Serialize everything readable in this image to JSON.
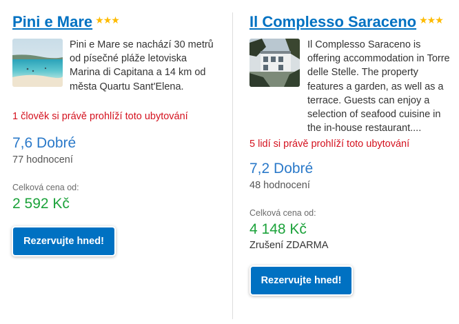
{
  "hotels": [
    {
      "name": "Pini e Mare",
      "stars": "★★★",
      "description": "Pini e Mare se nachází 30 metrů od písečné pláže letoviska Marina di Capitana a 14 km od města Quartu Sant'Elena.",
      "viewers": "1 člověk si právě prohlíží toto ubytování",
      "score": "7,6 Dobré",
      "reviews": "77 hodnocení",
      "price_label": "Celková cena od:",
      "price": "2 592 Kč",
      "button_label": "Rezervujte hned!"
    },
    {
      "name": "Il Complesso Saraceno",
      "stars": "★★★",
      "description": "Il Complesso Saraceno is offering accommodation in Torre delle Stelle. The property features a garden, as well as a terrace. Guests can enjoy a selection of seafood cuisine in the in-house restaurant....",
      "viewers": "5 lidí si právě prohlíží toto ubytování",
      "score": "7,2 Dobré",
      "reviews": "48 hodnocení",
      "price_label": "Celková cena od:",
      "price": "4 148 Kč",
      "cancellation": "Zrušení ZDARMA",
      "button_label": "Rezervujte hned!"
    }
  ]
}
